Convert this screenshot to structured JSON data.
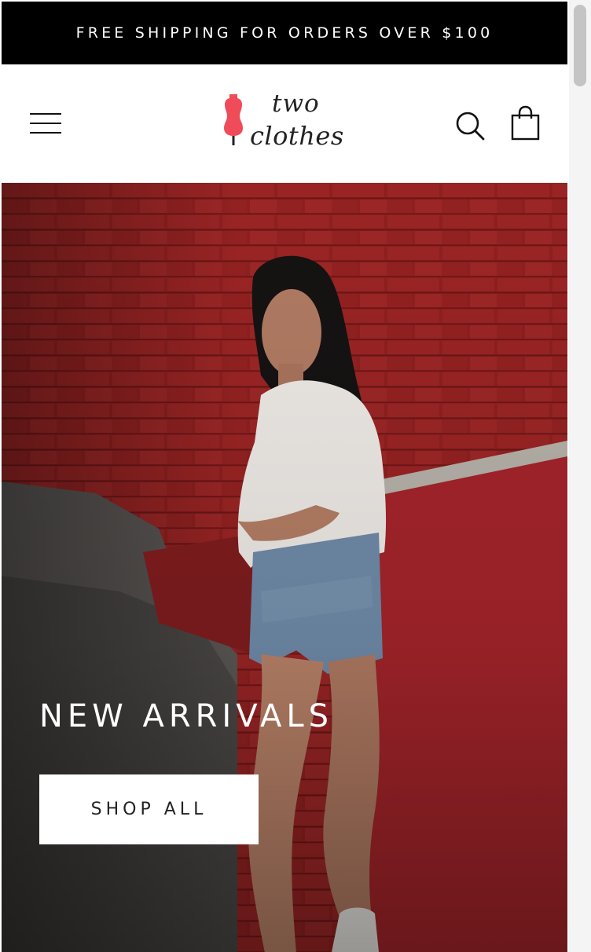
{
  "announcement": {
    "text": "FREE SHIPPING FOR ORDERS OVER $100"
  },
  "header": {
    "menu_icon": "hamburger-menu-icon",
    "logo": {
      "line1": "two",
      "line2": "clothes",
      "mark_icon": "dress-form-icon",
      "mark_color": "#ef4b59"
    },
    "search_icon": "search-icon",
    "cart_icon": "shopping-bag-icon"
  },
  "hero": {
    "title": "NEW ARRIVALS",
    "button_label": "SHOP ALL",
    "brick_color": "#8e1f1f",
    "wall_color": "#a3242a"
  }
}
